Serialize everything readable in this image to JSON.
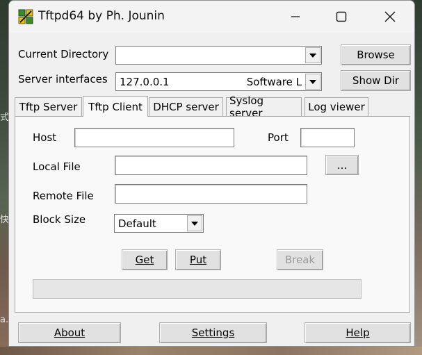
{
  "window": {
    "title": "Tftpd64 by Ph. Jounin"
  },
  "background_text": [
    "式",
    "快",
    "a."
  ],
  "top": {
    "current_directory_label": "Current Directory",
    "current_directory_value": "",
    "server_interfaces_label": "Server interfaces",
    "server_interface_ip": "127.0.0.1",
    "server_interface_name": "Software L",
    "browse_label": "Browse",
    "showdir_label": "Show Dir"
  },
  "tabs": [
    {
      "label": "Tftp Server",
      "active": false
    },
    {
      "label": "Tftp Client",
      "active": true
    },
    {
      "label": "DHCP server",
      "active": false
    },
    {
      "label": "Syslog server",
      "active": false
    },
    {
      "label": "Log viewer",
      "active": false
    }
  ],
  "client": {
    "host_label": "Host",
    "host_value": "",
    "port_label": "Port",
    "port_value": "",
    "local_file_label": "Local File",
    "local_file_value": "",
    "browse_dots": "...",
    "remote_file_label": "Remote File",
    "remote_file_value": "",
    "block_size_label": "Block Size",
    "block_size_value": "Default",
    "get_label": "Get",
    "put_label": "Put",
    "break_label": "Break",
    "progress": 0
  },
  "footer": {
    "about_label": "About",
    "settings_label": "Settings",
    "help_label": "Help"
  },
  "colors": {
    "window_bg": "#f0f0f0",
    "panel_bg": "#f9f9f9",
    "disabled_text": "#9a9a9a"
  }
}
